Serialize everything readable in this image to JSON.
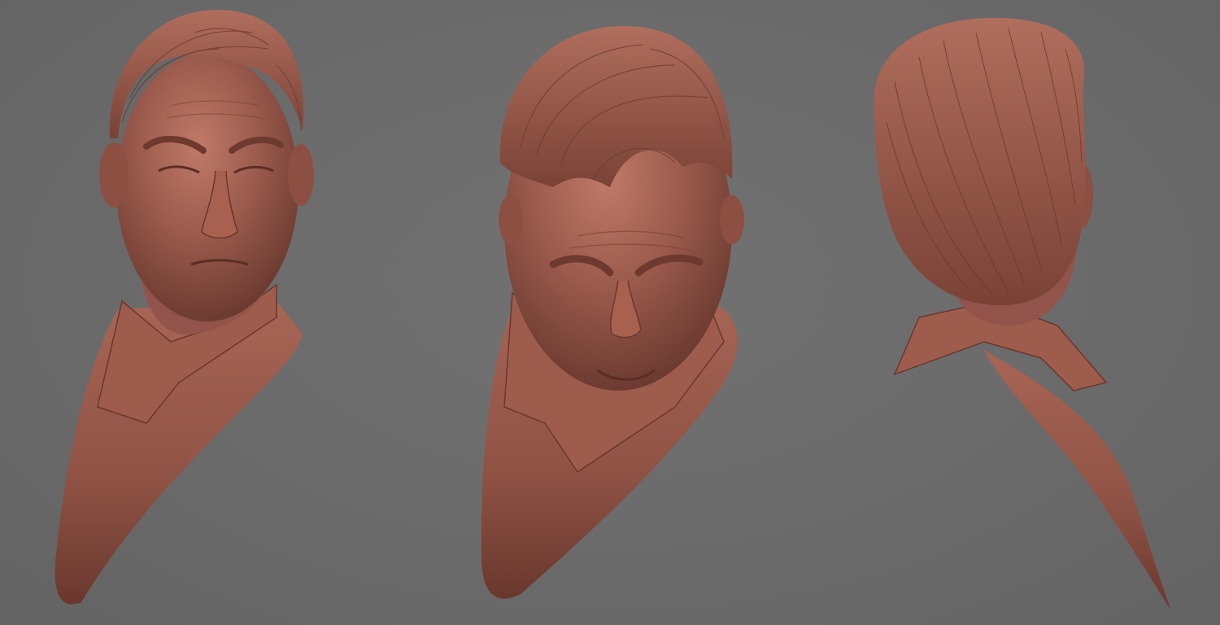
{
  "scene": {
    "description_free": true,
    "background_color": "#6b6b6b",
    "material_color": "#9a5a4c",
    "material_shadow": "#5e3128",
    "material_highlight": "#c07a68",
    "views": [
      {
        "id": "front",
        "name": "front-view"
      },
      {
        "id": "top",
        "name": "top-down-view"
      },
      {
        "id": "back",
        "name": "back-view"
      }
    ]
  }
}
